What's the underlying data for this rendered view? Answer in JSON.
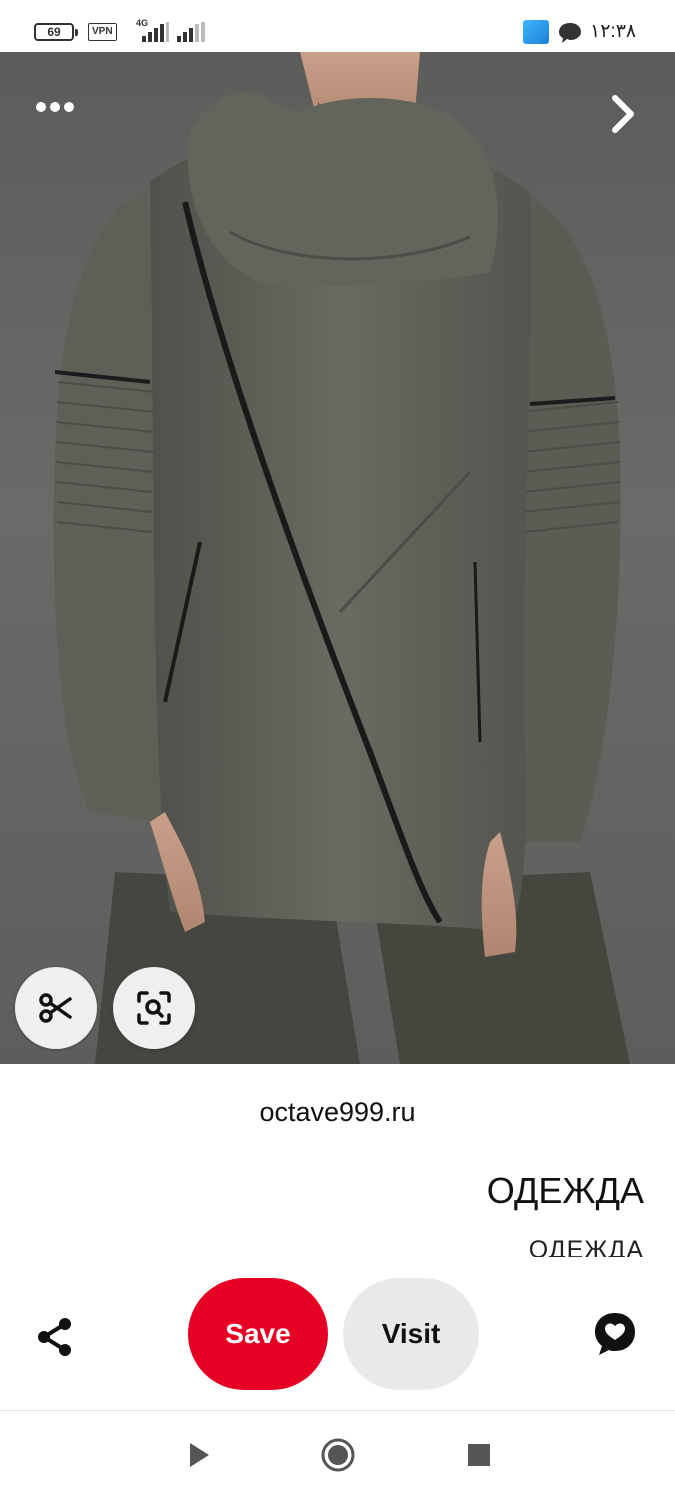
{
  "status_bar": {
    "battery": "69",
    "vpn": "VPN",
    "network_type": "4G",
    "time": "۱۲:۳۸"
  },
  "pin": {
    "more_icon": "more-horizontal-icon",
    "next_icon": "chevron-right-icon",
    "tools": [
      "scissors-icon",
      "visual-search-icon"
    ],
    "source": "octave999.ru",
    "title": "ОДЕЖДА",
    "description": "ОДЕЖДА"
  },
  "actions": {
    "share_icon": "share-icon",
    "save_label": "Save",
    "visit_label": "Visit",
    "comment_icon": "comment-heart-icon"
  },
  "colors": {
    "save_bg": "#e60023",
    "visit_bg": "#e9e9e9",
    "hoodie": "#5f6157"
  },
  "nav_bar": [
    "back-icon",
    "home-icon",
    "recents-icon"
  ]
}
